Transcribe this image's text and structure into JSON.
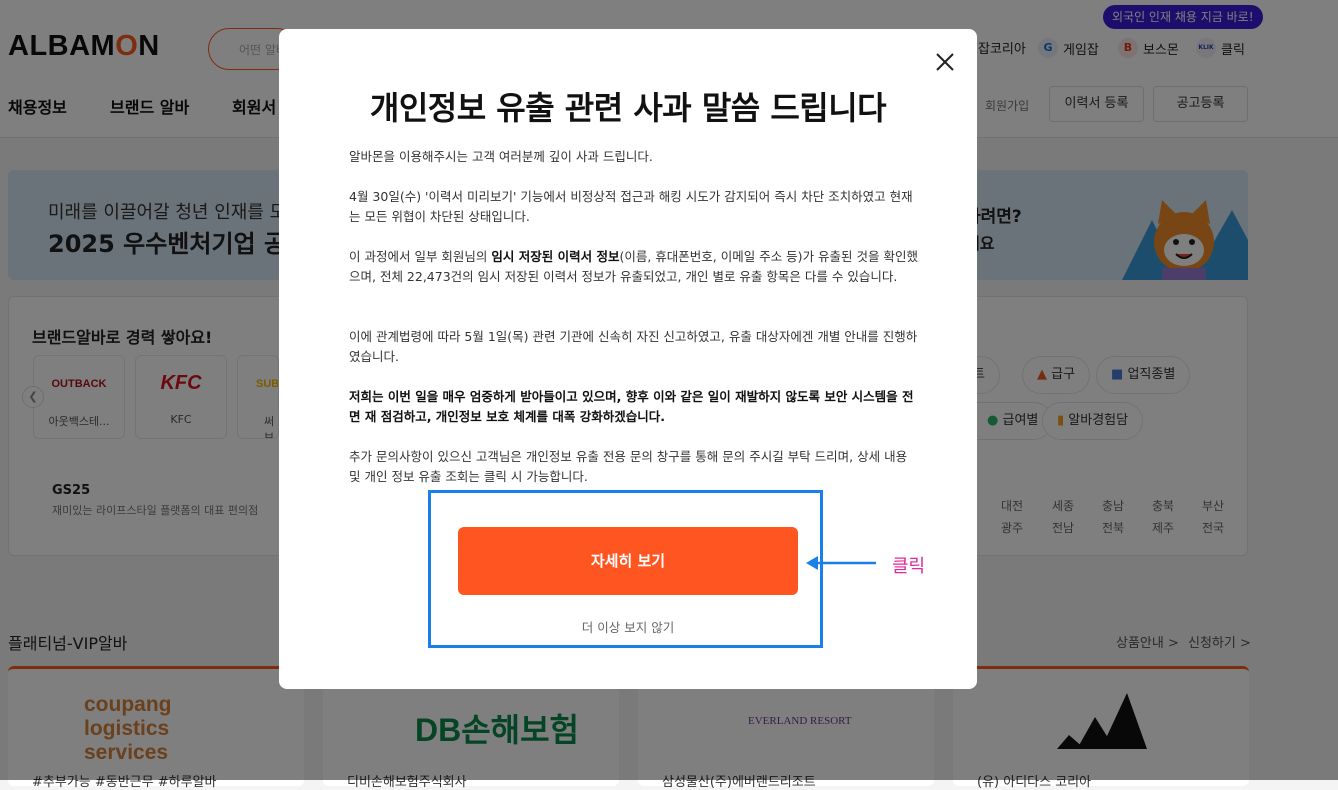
{
  "header": {
    "logo_text": "ALBAMON",
    "search_placeholder": "어떤 알바",
    "promo_badge": "외국인 인재 채용 지금 바로!",
    "sites": [
      {
        "label": "잡코리아",
        "icon": "jobkorea-icon"
      },
      {
        "label": "게임잡",
        "icon": "gamejob-icon",
        "glyph": "G"
      },
      {
        "label": "보스몬",
        "icon": "bossmon-icon",
        "glyph": "B"
      },
      {
        "label": "클릭",
        "icon": "klik-icon",
        "glyph": "KLIK"
      }
    ],
    "nav": [
      "채용정보",
      "브랜드 알바",
      "회원서"
    ],
    "join_label": "회원가입",
    "resume_button": "이력서 등록",
    "post_button": "공고등록"
  },
  "banner": {
    "line1": "미래를 이끌어갈 청년 인재를 모",
    "line2": "2025 우수벤처기업 공",
    "right_line1": "하려면?",
    "right_line2": "세요"
  },
  "brand_section": {
    "title": "브랜드알바로 경력 쌓아요!",
    "brands": [
      {
        "logo": "OUTBACK",
        "name": "아웃백스테..."
      },
      {
        "logo": "KFC",
        "name": "KFC"
      },
      {
        "logo": "SUB",
        "name": "써브"
      }
    ],
    "featured": {
      "title": "GS25",
      "subtitle": "재미있는 라이프스타일 플랫폼의 대표 편의점"
    },
    "chips": [
      "제트",
      "급구",
      "업직종별",
      "급여별",
      "알바경험담"
    ],
    "regions_row1": [
      "대전",
      "세종",
      "충남",
      "충북",
      "부산"
    ],
    "regions_row2": [
      "광주",
      "전남",
      "전북",
      "제주",
      "전국"
    ]
  },
  "vip": {
    "title": "플래티넘-VIP알바",
    "product_info": "상품안내 >",
    "apply": "신청하기 >",
    "companies": [
      {
        "logo": "coupang logistics services",
        "name": "#추부가능 #동반근무 #하루알바"
      },
      {
        "logo": "DB손해보험",
        "name": "디비손해보험주식회사"
      },
      {
        "logo": "EVERLAND RESORT",
        "name": "삼성물산(주)에버랜드리조트"
      },
      {
        "logo": "adidas",
        "name": "(유) 아디다스 코리아"
      }
    ]
  },
  "modal": {
    "title": "개인정보 유출 관련 사과 말씀 드립니다",
    "p1": "알바몬을 이용해주시는 고객 여러분께 깊이 사과 드립니다.",
    "p2": "4월 30일(수) '이력서 미리보기' 기능에서 비정상적 접근과 해킹 시도가 감지되어 즉시 차단 조치하였고 현재는 모든 위협이 차단된 상태입니다.",
    "p3_a": "이 과정에서 일부 회원님의 ",
    "p3_b": "임시 저장된 이력서 정보",
    "p3_c": "(이름, 휴대폰번호, 이메일 주소 등)가 유출된 것을 확인했으며, 전체 22,473건의 임시 저장된 이력서 정보가 유출되었고, 개인 별로 유출 항목은 다를 수 있습니다.",
    "p4": "이에 관계법령에 따라 5월 1일(목) 관련 기관에 신속히 자진 신고하였고, 유출 대상자에겐 개별 안내를 진행하였습니다.",
    "p5": "저희는 이번 일을 매우 엄중하게 받아들이고 있으며, 향후 이와 같은 일이 재발하지 않도록 보안 시스템을 전면 재 점검하고, 개인정보 보호 체계를 대폭 강화하겠습니다.",
    "p6": "추가 문의사항이 있으신 고객님은 개인정보 유출 전용 문의 창구를 통해 문의 주시길 부탁 드리며, 상세 내용 및 개인 정보 유출 조회는 클릭 시 가능합니다.",
    "detail_button": "자세히 보기",
    "dismiss_label": "더 이상 보지 않기"
  },
  "annotation": {
    "click_label": "클릭",
    "box_color": "#1a80e8",
    "label_color": "#e0289a"
  },
  "colors": {
    "brand": "#ff5a1f",
    "button": "#ff5521"
  }
}
